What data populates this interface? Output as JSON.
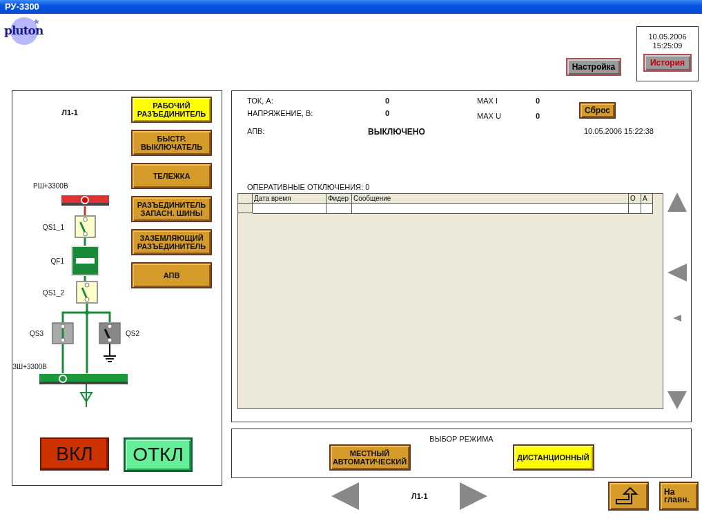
{
  "window": {
    "title": "РУ-3300"
  },
  "logo": {
    "text": "pluton"
  },
  "header": {
    "settings_button": "Настройка",
    "date": "10.05.2006",
    "time": "15:25:09",
    "history_button": "История"
  },
  "left_panel": {
    "feeder": "Л1-1",
    "schematic": {
      "top_bus": "РШ+3300В",
      "bottom_bus": "ЗШ+3300В",
      "devices": [
        {
          "label": "QS1_1",
          "kind": "disconnector",
          "closed": false,
          "color": "#ffffcc"
        },
        {
          "label": "QF1",
          "kind": "breaker",
          "closed": false,
          "color": "#1a8a3a"
        },
        {
          "label": "QS1_2",
          "kind": "disconnector",
          "closed": false,
          "color": "#ffffcc"
        },
        {
          "label": "QS3",
          "kind": "disconnector",
          "closed": true,
          "color": "#aaaaaa"
        },
        {
          "label": "QS2",
          "kind": "earthing",
          "closed": false,
          "color": "#888888"
        }
      ]
    },
    "device_buttons": [
      {
        "label": "РАБОЧИЙ\nРАЗЪЕДИНИТЕЛЬ",
        "selected": true
      },
      {
        "label": "БЫСТР.\nВЫКЛЮЧАТЕЛЬ",
        "selected": false
      },
      {
        "label": "ТЕЛЕЖКА",
        "selected": false
      },
      {
        "label": "РАЗЪЕДИНИТЕЛЬ\nЗАПАСН. ШИНЫ",
        "selected": false
      },
      {
        "label": "ЗАЗЕМЛЯЮЩИЙ\nРАЗЪЕДИНИТЕЛЬ",
        "selected": false
      },
      {
        "label": "АПВ",
        "selected": false
      }
    ],
    "on_button": "ВКЛ",
    "off_button": "ОТКЛ"
  },
  "info_panel": {
    "current_label": "ТОК, А:",
    "current_value": "0",
    "max_i_label": "MAX  I",
    "max_i_value": "0",
    "voltage_label": "НАПРЯЖЕНИЕ, В:",
    "voltage_value": "0",
    "max_u_label": "MAX  U",
    "max_u_value": "0",
    "reset_button": "Сброс",
    "ar_label": "АПВ:",
    "ar_value": "ВЫКЛЮЧЕНО",
    "timestamp": "10.05.2006 15:22:38",
    "trips_label": "ОПЕРАТИВНЫЕ ОТКЛЮЧЕНИЯ: 0",
    "table": {
      "columns": [
        "Дата время",
        "Фидер",
        "Сообщение",
        "О",
        "А"
      ]
    }
  },
  "mode_panel": {
    "title": "ВЫБОР РЕЖИМА",
    "modes": [
      {
        "label": "МЕСТНЫЙ\nАВТОМАТИЧЕСКИЙ",
        "selected": false
      },
      {
        "label": "ДИСТАНЦИОННЫЙ",
        "selected": true
      }
    ]
  },
  "nav": {
    "feeder": "Л1-1",
    "home_button": "На\nглавн."
  }
}
